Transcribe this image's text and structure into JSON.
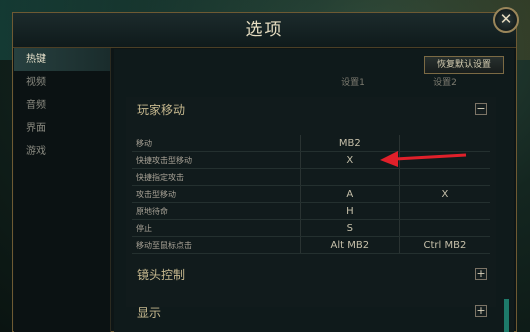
{
  "dialog": {
    "title": "选项",
    "close_symbol": "✕",
    "reset_button": "恢复默认设置"
  },
  "sidebar": {
    "items": [
      {
        "label": "热键",
        "active": true
      },
      {
        "label": "视频",
        "active": false
      },
      {
        "label": "音频",
        "active": false
      },
      {
        "label": "界面",
        "active": false
      },
      {
        "label": "游戏",
        "active": false
      }
    ]
  },
  "sections": {
    "player_move": {
      "title": "玩家移动",
      "toggle": "−"
    },
    "camera": {
      "title": "镜头控制",
      "toggle": "+"
    },
    "display": {
      "title": "显示",
      "toggle": "+"
    }
  },
  "columns": {
    "setting1": "设置1",
    "setting2": "设置2"
  },
  "bindings": [
    {
      "action": "移动",
      "key1": "MB2",
      "key2": ""
    },
    {
      "action": "快捷攻击型移动",
      "key1": "X",
      "key2": ""
    },
    {
      "action": "快捷指定攻击",
      "key1": "",
      "key2": ""
    },
    {
      "action": "攻击型移动",
      "key1": "A",
      "key2": "X"
    },
    {
      "action": "原地待命",
      "key1": "H",
      "key2": ""
    },
    {
      "action": "停止",
      "key1": "S",
      "key2": ""
    },
    {
      "action": "移动至鼠标点击",
      "key1": "Alt  MB2",
      "key2": "Ctrl  MB2"
    }
  ],
  "colors": {
    "accent_gold": "#9a865a",
    "annotation_arrow": "#e0202a",
    "scroll_teal": "#1d7a6a"
  }
}
